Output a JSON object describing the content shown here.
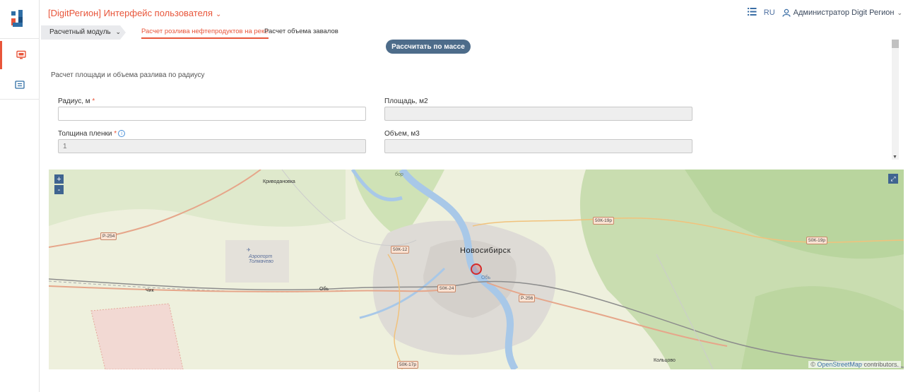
{
  "header": {
    "app_title": "[DigitРегион] Интерфейс пользователя",
    "lang": "RU",
    "user_name": "Администратор Digit Регион"
  },
  "tabs": {
    "module": "Расчетный модуль",
    "items": [
      {
        "label": "Расчет розлива нефтепродуктов на реке",
        "active": true
      },
      {
        "label": "Расчет объема завалов",
        "active": false
      }
    ]
  },
  "form": {
    "calc_button": "Рассчитать по массе",
    "section_title": "Расчет площади и объема разлива по радиусу",
    "radius_label": "Радиус, м",
    "area_label": "Площадь, м2",
    "thickness_label": "Толщина пленки",
    "volume_label": "Объем, м3",
    "radius_value": "",
    "area_value": "",
    "thickness_value": "1",
    "volume_value": "",
    "required_mark": "*",
    "info_glyph": "i"
  },
  "map": {
    "zoom_in": "+",
    "zoom_out": "-",
    "attribution_prefix": "©",
    "attribution_link": "OpenStreetMap",
    "attribution_suffix": "contributors.",
    "labels": {
      "city": "Новосибирск",
      "krivodanovka": "Криводановка",
      "chik": "Чик",
      "ob": "Обь",
      "ob_river": "Обь",
      "airport": "Аэропорт Толмачево",
      "koltsovo": "Кольцово",
      "bor": "бор"
    },
    "roads": [
      "Р-254",
      "50К-12",
      "50К-24",
      "Р-256",
      "50К-19р",
      "50К-19р",
      "50К-17р"
    ]
  }
}
